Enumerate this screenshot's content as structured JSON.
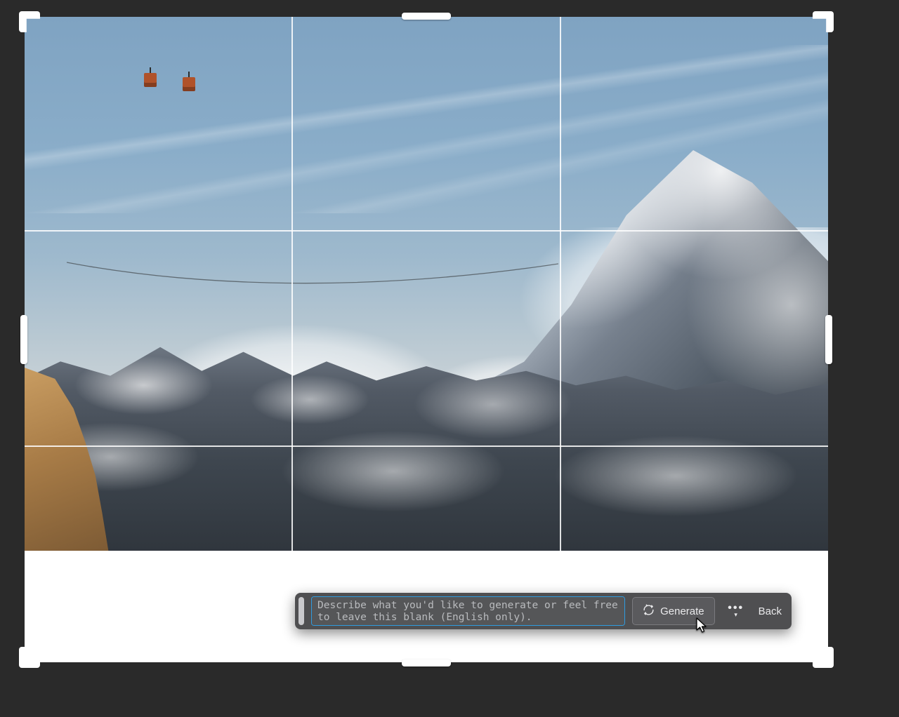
{
  "prompt": {
    "placeholder": "Describe what you'd like to generate or feel free to leave this blank (English only).",
    "value": ""
  },
  "toolbar": {
    "generate_label": "Generate",
    "back_label": "Back",
    "more_label": "•••"
  },
  "icons": {
    "generate": "sparkle-refresh-icon",
    "more": "ellipsis-icon",
    "dropdown": "caret-down-icon"
  }
}
